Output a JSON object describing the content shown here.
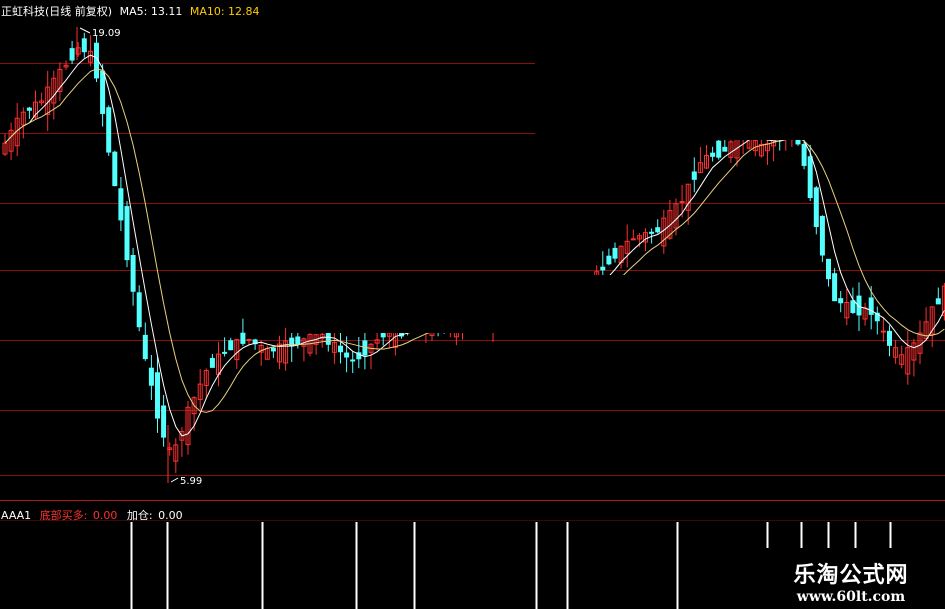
{
  "header": {
    "stock": "正虹科技(日线 前复权)",
    "ma5_label": "MA5:",
    "ma5_value": "13.11",
    "ma10_label": "MA10:",
    "ma10_value": "12.84"
  },
  "annotations": {
    "high": "19.09",
    "low": "5.99"
  },
  "indicator": {
    "name": "AAA1",
    "buy_label": "底部买多:",
    "buy_value": "0.00",
    "add_label": "加仓:",
    "add_value": "0.00"
  },
  "watermark": {
    "name": "乐淘公式网",
    "url": "www.60lt.com"
  },
  "colors": {
    "up": "#ff3030",
    "down": "#54ffff",
    "ma5": "#ffffff",
    "ma10": "#e8d080",
    "grid": "#8a1010",
    "text": "#ffffff",
    "ma10_text": "#ffcc00",
    "buy_text": "#ff3030"
  },
  "chart_data": {
    "type": "candlestick",
    "price_high": 19.09,
    "price_low": 5.99,
    "series": [
      {
        "name": "MA5"
      },
      {
        "name": "MA10"
      }
    ],
    "signal_count": 13
  }
}
